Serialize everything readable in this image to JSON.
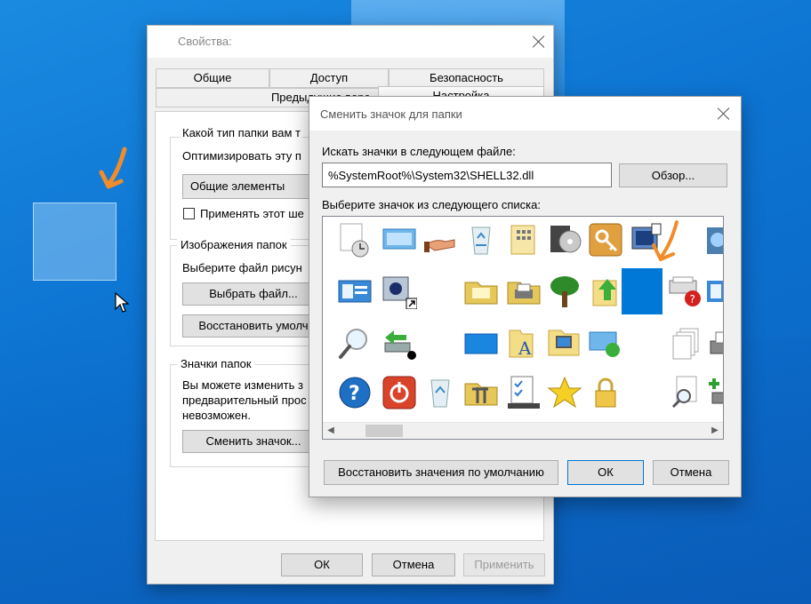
{
  "properties_window": {
    "title": "Свойства:",
    "tabs_row1": [
      "Общие",
      "Доступ",
      "Безопасность"
    ],
    "tabs_row2": [
      "Предыдущие верс",
      "Настройка"
    ],
    "folder_type": {
      "question": "Какой тип папки вам т",
      "optimize_label": "Оптимизировать эту п",
      "combo_value": "Общие элементы",
      "apply_checkbox_label": "Применять этот ше"
    },
    "folder_images": {
      "title": "Изображения папок",
      "choose_text": "Выберите файл рисун",
      "choose_file_button": "Выбрать файл...",
      "restore_default_button": "Восстановить умолч"
    },
    "folder_icons": {
      "title": "Значки папок",
      "line1": "Вы можете изменить з",
      "line2": "предварительный прос",
      "line3": "невозможен.",
      "change_icon_button": "Сменить значок..."
    },
    "buttons": {
      "ok": "ОК",
      "cancel": "Отмена",
      "apply": "Применить"
    }
  },
  "change_icon_dialog": {
    "title": "Сменить значок для папки",
    "file_label": "Искать значки в следующем файле:",
    "file_path": "%SystemRoot%\\System32\\SHELL32.dll",
    "browse_button": "Обзор...",
    "list_label": "Выберите значок из следующего списка:",
    "restore_defaults_button": "Восстановить значения по умолчанию",
    "ok_button": "ОК",
    "cancel_button": "Отмена",
    "selected_icon_index": 14
  },
  "colors": {
    "desktop_blue": "#0d74d2",
    "selection_blue": "#0078d7",
    "annotation_orange": "#f28c28",
    "window_bg": "#f0f0f0"
  }
}
